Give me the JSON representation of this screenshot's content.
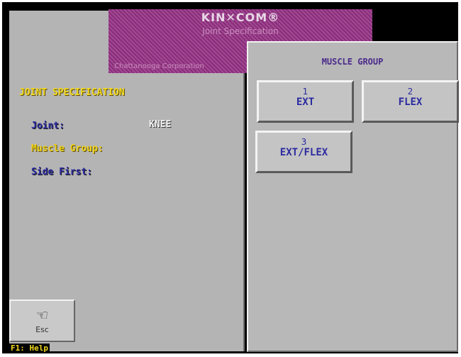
{
  "banner": {
    "logo": "KIN✕COM®",
    "subtitle": "Joint Specification",
    "footer": "Chattanooga Corporation"
  },
  "spec": {
    "title": "JOINT SPECIFICATION",
    "joint_label": "Joint:",
    "joint_value": "KNEE",
    "muscle_group_label": "Muscle Group:",
    "side_first_label": "Side First:"
  },
  "esc": {
    "label": "Esc",
    "icon": "pointing-hand-icon"
  },
  "help": {
    "label": "F1: Help"
  },
  "dialog": {
    "title": "MUSCLE GROUP",
    "options": [
      {
        "num": "1",
        "label": "EXT"
      },
      {
        "num": "2",
        "label": "FLEX"
      },
      {
        "num": "3",
        "label": "EXT/FLEX"
      }
    ]
  },
  "colors": {
    "yellow": "#f3d91e",
    "blue": "#2b2aa0",
    "panel": "#b4b4b4",
    "banner": "#8a2c7a"
  }
}
